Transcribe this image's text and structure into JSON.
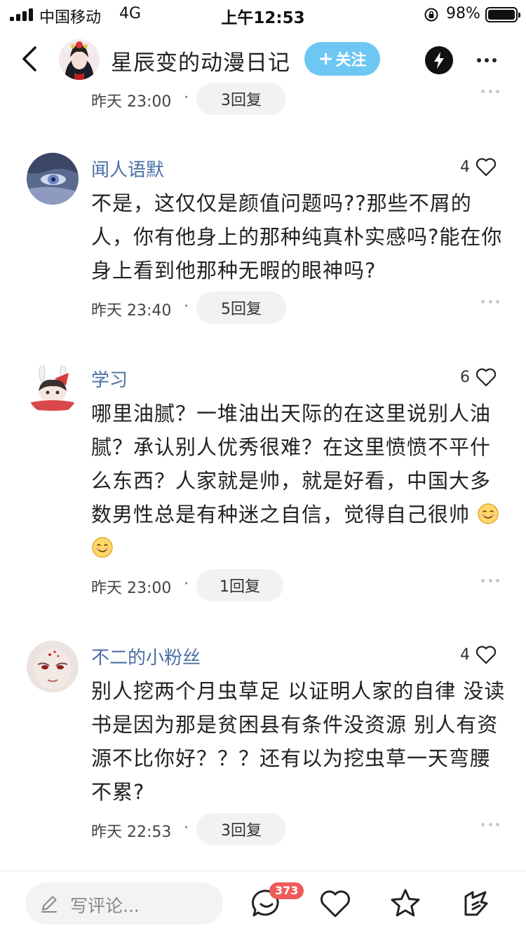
{
  "status_bar": {
    "carrier": "中国移动",
    "network": "4G",
    "time": "上午12:53",
    "battery_pct": "98%"
  },
  "header": {
    "title": "星辰变的动漫日记",
    "follow_label": "关注",
    "accent_color": "#6ec7f2"
  },
  "top_meta": {
    "date": "昨天 23:00",
    "dot": "·",
    "reply_label": "3回复"
  },
  "comments": [
    {
      "name": "闻人语默",
      "likes": "4",
      "text": "不是，这仅仅是颜值问题吗??那些不屑的人，你有他身上的那种纯真朴实感吗?能在你身上看到他那种无暇的眼神吗?",
      "date": "昨天 23:40",
      "dot": "·",
      "reply_label": "5回复"
    },
    {
      "name": "学习",
      "likes": "6",
      "text": "哪里油腻？一堆油出天际的在这里说别人油腻？承认别人优秀很难？在这里愤愤不平什么东西？人家就是帅，就是好看，中国大多数男性总是有种迷之自信，觉得自己很帅",
      "emoji_count": 2,
      "date": "昨天 23:00",
      "dot": "·",
      "reply_label": "1回复"
    },
    {
      "name": "不二的小粉丝",
      "likes": "4",
      "text": "别人挖两个月虫草足 以证明人家的自律 没读书是因为那是贫困县有条件没资源 别人有资源不比你好？？？还有以为挖虫草一天弯腰不累?",
      "date": "昨天 22:53",
      "dot": "·",
      "reply_label": "3回复"
    }
  ],
  "bottom_bar": {
    "comment_placeholder": "写评论...",
    "comment_count": "373",
    "icons": [
      "comment-icon",
      "like-icon",
      "favorite-icon",
      "share-icon"
    ]
  }
}
